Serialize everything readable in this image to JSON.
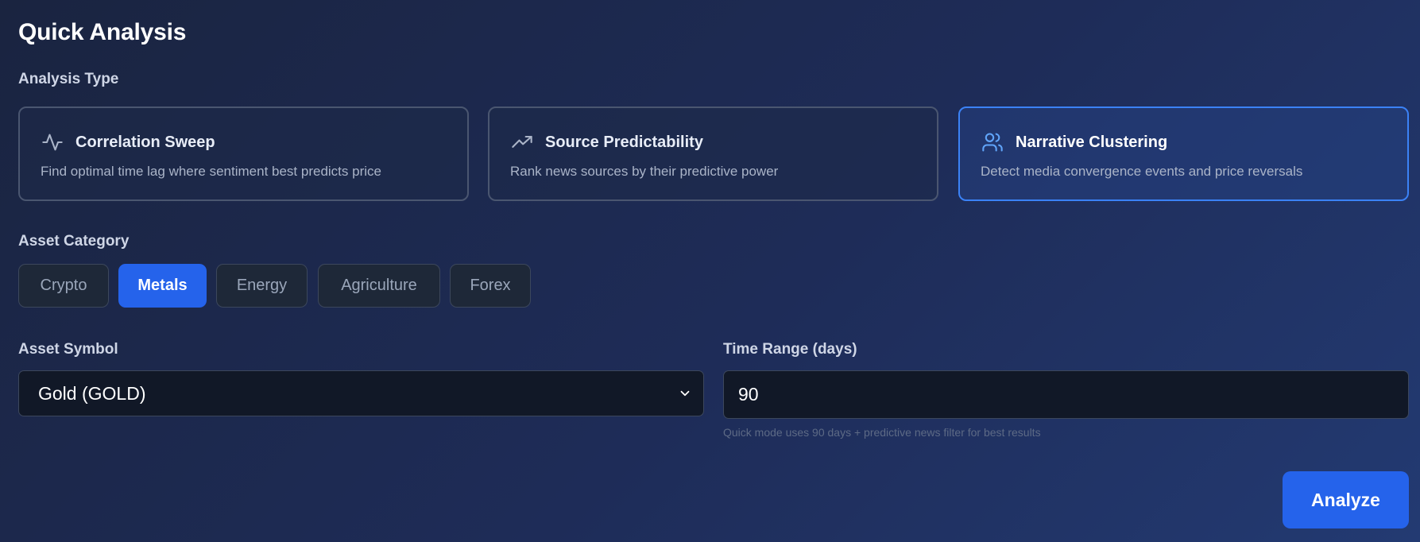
{
  "title": "Quick Analysis",
  "analysis_type": {
    "label": "Analysis Type",
    "cards": [
      {
        "icon": "activity-pulse-icon",
        "title": "Correlation Sweep",
        "description": "Find optimal time lag where sentiment best predicts price",
        "selected": false
      },
      {
        "icon": "trending-up-icon",
        "title": "Source Predictability",
        "description": "Rank news sources by their predictive power",
        "selected": false
      },
      {
        "icon": "users-icon",
        "title": "Narrative Clustering",
        "description": "Detect media convergence events and price reversals",
        "selected": true
      }
    ]
  },
  "asset_category": {
    "label": "Asset Category",
    "options": [
      "Crypto",
      "Metals",
      "Energy",
      "Agriculture",
      "Forex"
    ],
    "selected": "Metals"
  },
  "asset_symbol": {
    "label": "Asset Symbol",
    "value": "Gold (GOLD)"
  },
  "time_range": {
    "label": "Time Range (days)",
    "value": "90",
    "hint": "Quick mode uses 90 days + predictive news filter for best results"
  },
  "analyze_button": "Analyze",
  "colors": {
    "accent": "#2563eb",
    "selected_border": "#3b82f6",
    "background": "#1e2c58",
    "input_bg": "#111827"
  }
}
